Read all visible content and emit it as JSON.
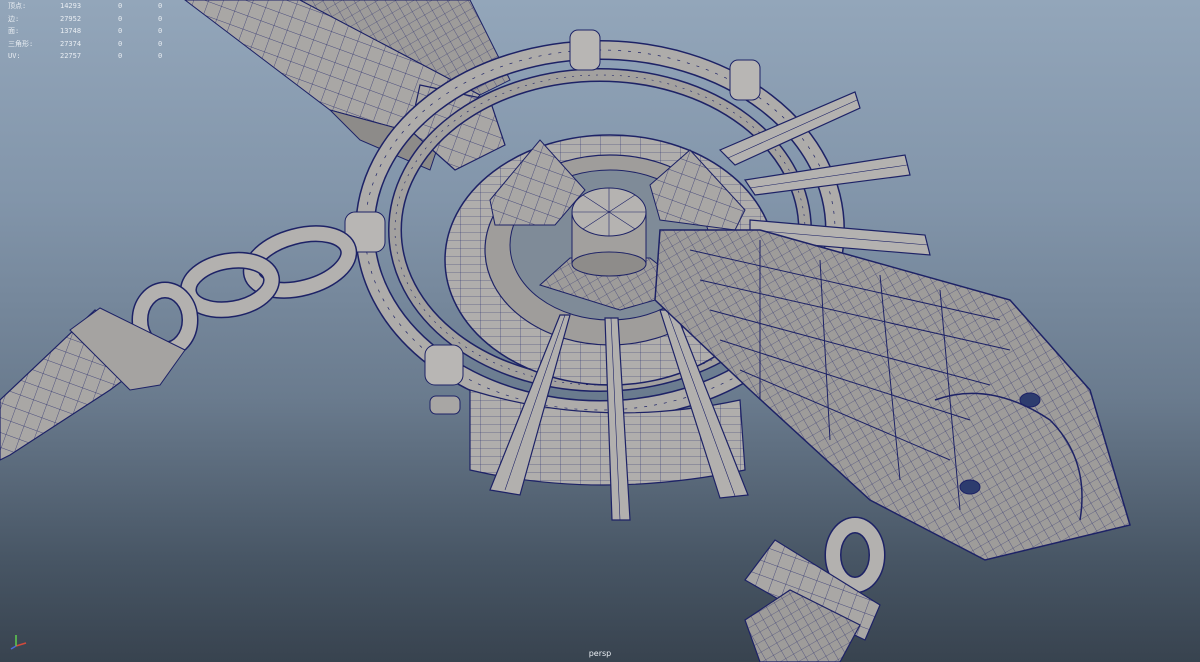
{
  "viewport": {
    "camera": "persp",
    "background_top": "#93a6ba",
    "background_bottom": "#38434f",
    "wire_color": "#1d2266",
    "mesh_color": "#a9a7a5"
  },
  "stats": [
    {
      "label": "顶点:",
      "total": "14293",
      "selected": "0",
      "component": "0"
    },
    {
      "label": "边:",
      "total": "27952",
      "selected": "0",
      "component": "0"
    },
    {
      "label": "面:",
      "total": "13748",
      "selected": "0",
      "component": "0"
    },
    {
      "label": "三角形:",
      "total": "27374",
      "selected": "0",
      "component": "0"
    },
    {
      "label": "UV:",
      "total": "22757",
      "selected": "0",
      "component": "0"
    }
  ],
  "axis_gizmo": {
    "x_color": "#d24a3c",
    "y_color": "#5fcf4e",
    "z_color": "#4a6bd8"
  },
  "icons": [
    "axis-gizmo-icon"
  ]
}
